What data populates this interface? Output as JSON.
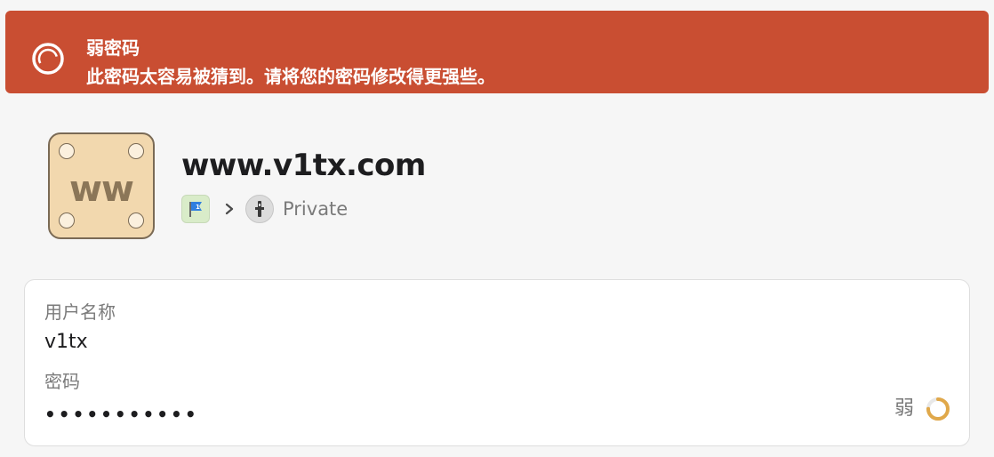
{
  "banner": {
    "title": "弱密码",
    "message": "此密码太容易被猜到。请将您的密码修改得更强些。",
    "color": "#c94e32"
  },
  "item": {
    "tile_text": "ww",
    "title": "www.v1tx.com",
    "breadcrumb": {
      "account_icon": "flag-icon",
      "separator_icon": "chevron-right-icon",
      "vault_icon": "keyhole-icon",
      "vault_label": "Private"
    }
  },
  "fields": {
    "username": {
      "label": "用户名称",
      "value": "v1tx"
    },
    "password": {
      "label": "密码",
      "value": "•••••••••••",
      "strength_label": "弱",
      "strength_color": "#e0a84a",
      "strength_level": 0.25
    }
  }
}
